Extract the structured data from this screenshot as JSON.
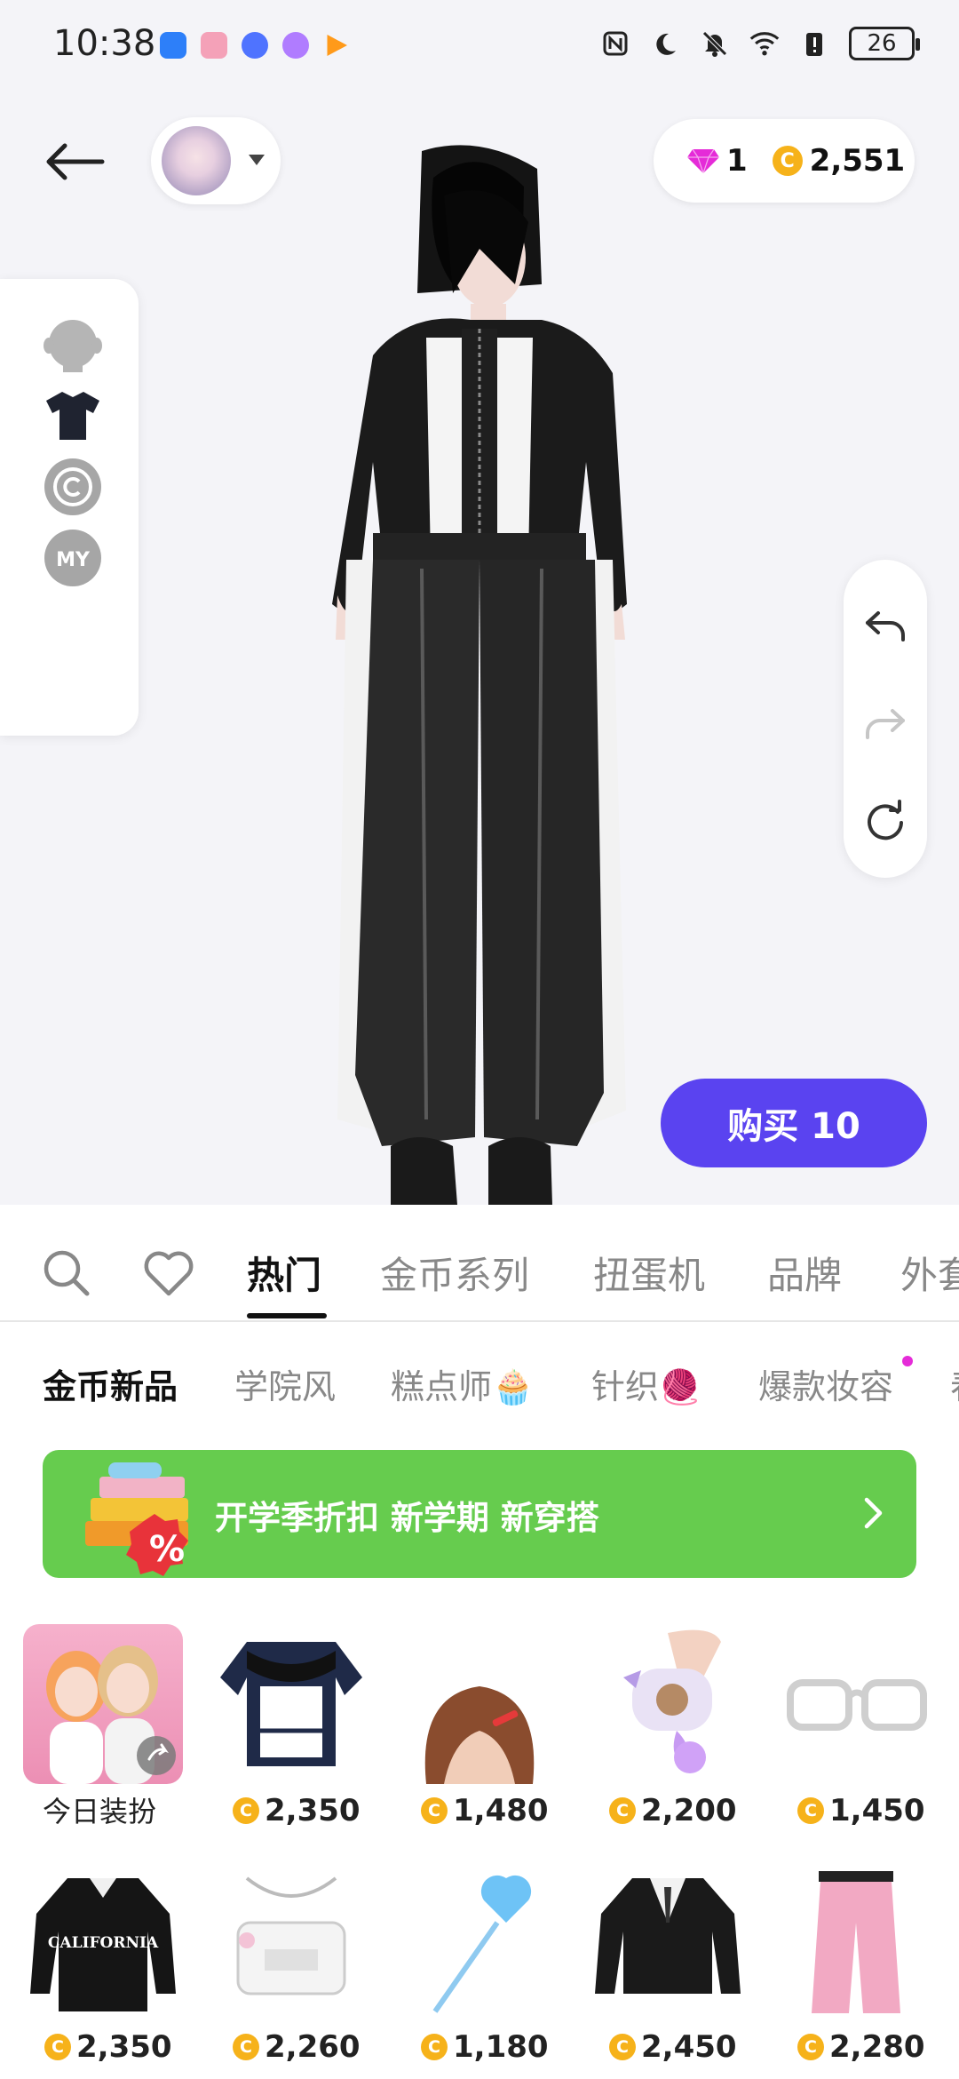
{
  "status_bar": {
    "time": "10:38",
    "battery": "26"
  },
  "header": {
    "gems": "1",
    "coins": "2,551"
  },
  "buy_button": "购买 10",
  "tabs": [
    "热门",
    "金币系列",
    "扭蛋机",
    "品牌",
    "外套"
  ],
  "subtabs": [
    "金币新品",
    "学院风",
    "糕点师🧁",
    "针织🧶",
    "爆款妆容",
    "春"
  ],
  "banner": {
    "text": "开学季折扣 新学期 新穿搭",
    "color": "#66cc4e"
  },
  "items": [
    {
      "label": "今日装扮",
      "icon": "today-outfit-thumbnail"
    },
    {
      "price": "2,350",
      "icon": "varsity-tee-icon"
    },
    {
      "price": "1,480",
      "icon": "brown-hair-clip-icon"
    },
    {
      "price": "2,200",
      "icon": "bear-bag-icon"
    },
    {
      "price": "1,450",
      "icon": "glasses-icon"
    },
    {
      "price": "2,350",
      "icon": "california-sweatshirt-icon"
    },
    {
      "price": "2,260",
      "icon": "white-bag-icon"
    },
    {
      "price": "1,180",
      "icon": "heart-lollipop-icon"
    },
    {
      "price": "2,450",
      "icon": "black-cardigan-icon"
    },
    {
      "price": "2,280",
      "icon": "pink-pants-icon"
    }
  ],
  "colors": {
    "accent": "#5a43f0",
    "coin": "#f6b21a",
    "gem": "#e52bd8",
    "banner": "#66cc4e"
  }
}
